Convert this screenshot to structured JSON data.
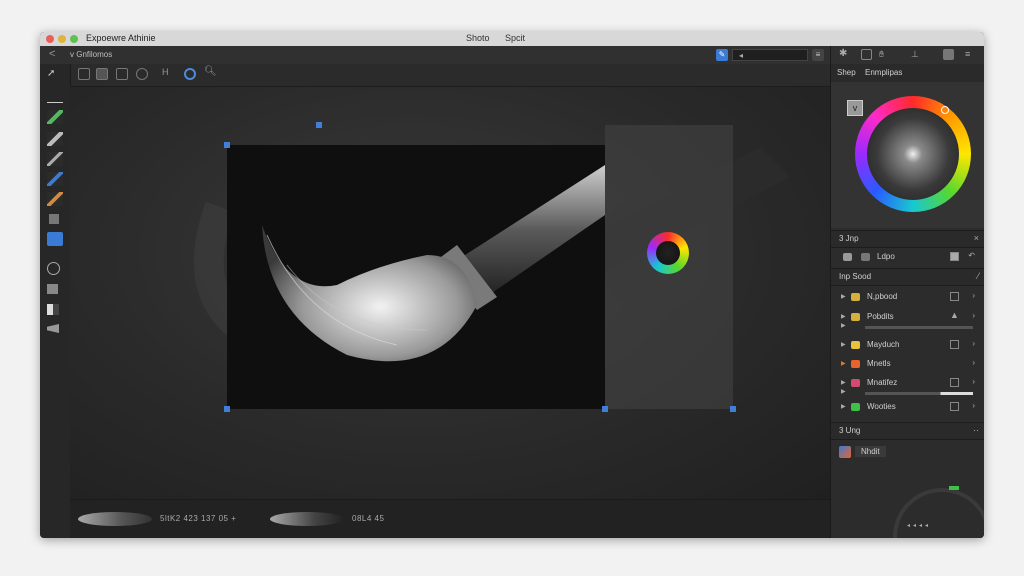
{
  "window": {
    "app_title": "Expoewre Athinie",
    "menu": [
      "Shoto",
      "Spcit"
    ],
    "traffic_lights": [
      "#ec5f57",
      "#e0b33c",
      "#5fc153"
    ]
  },
  "topbar": {
    "back_label": "<",
    "document_title": "v  Gnfilomos",
    "mode_value": "◂"
  },
  "status": {
    "text_1": "5ltK2  423   137   05  +",
    "text_2": "08L4   45"
  },
  "panels": {
    "tabs": [
      "Shep",
      "Enmplipas"
    ],
    "color_swatch": "v",
    "layers_header": "3 Jnp",
    "layer_title": "Ldpo",
    "adjust_header": "Inp Sood",
    "adjustments": [
      {
        "label": "N,pbood",
        "icon_color": "#d4b13a"
      },
      {
        "label": "Pobdits",
        "icon_color": "#d4b13a"
      },
      {
        "label": "Mayduch",
        "icon_color": "#e8c23a"
      },
      {
        "label": "Mnetls",
        "icon_color": "#e8642a"
      },
      {
        "label": "Mnatifez",
        "icon_color": "#d04a72"
      },
      {
        "label": "Wooties",
        "icon_color": "#3fbf4a"
      }
    ],
    "fx_header": "3 Ung",
    "fx_item": "Nhdit"
  },
  "colors": {
    "accent": "#3a7bd5"
  }
}
